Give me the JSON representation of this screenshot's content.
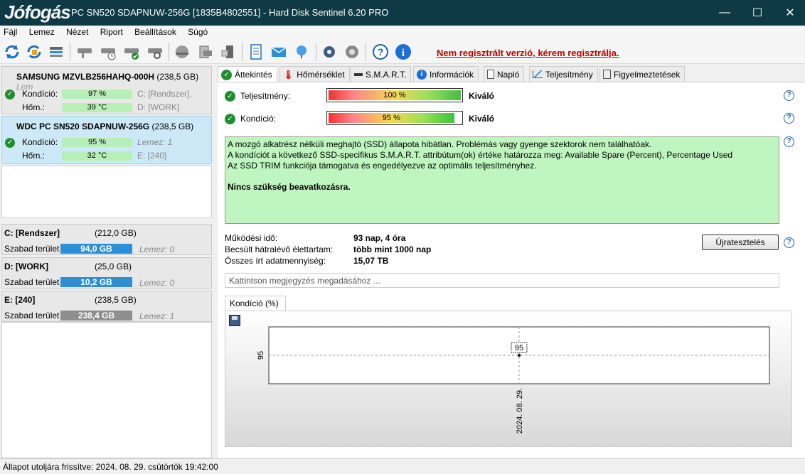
{
  "window": {
    "watermark": "Jófogás",
    "title": "PC SN520 SDAPNUW-256G [1835B4802551]  -  Hard Disk Sentinel 6.20 PRO",
    "minimize": "—",
    "maximize": "☐",
    "close": "✕"
  },
  "menu": [
    "Fájl",
    "Lemez",
    "Nézet",
    "Riport",
    "Beállítások",
    "Súgó"
  ],
  "toolbar": {
    "register_note": "Nem regisztrált verzió, kérem regisztrálja."
  },
  "disks": [
    {
      "name": "SAMSUNG MZVLB256HAHQ-000H",
      "size": "(238,5 GB)",
      "extra": "Lem",
      "condition_label": "Kondíció:",
      "condition": "97 %",
      "condition_pct": 97,
      "temp_label": "Hőm.:",
      "temp": "39 °C",
      "vol1": "C: [Rendszer],",
      "vol2": "D: [WORK]"
    },
    {
      "name": "WDC PC SN520 SDAPNUW-256G",
      "size": "(238,5 GB)",
      "condition_label": "Kondíció:",
      "condition": "95 %",
      "condition_pct": 95,
      "temp_label": "Hőm.:",
      "temp": "32 °C",
      "vol1": "Lemez: 1",
      "vol2": "E: [240]"
    }
  ],
  "partitions": [
    {
      "name": "C: [Rendszer]",
      "size": "(212,0 GB)",
      "free_label": "Szabad terület",
      "free": "94,0 GB",
      "color": "#2d8fd6",
      "disk": "Lemez: 0"
    },
    {
      "name": "D: [WORK]",
      "size": "(25,0 GB)",
      "free_label": "Szabad terület",
      "free": "10,2 GB",
      "color": "#2d8fd6",
      "disk": "Lemez: 0"
    },
    {
      "name": "E: [240]",
      "size": "(238,5 GB)",
      "free_label": "Szabad terület",
      "free": "238,4 GB",
      "color": "#8e8e8e",
      "disk": "Lemez: 1"
    }
  ],
  "tabs": [
    "Áttekintés",
    "Hőmérséklet",
    "S.M.A.R.T.",
    "Információk",
    "Napló",
    "Teljesítmény",
    "Figyelmeztetések"
  ],
  "overview": {
    "performance_label": "Teljesítmény:",
    "performance_value": "100 %",
    "performance_pct": 100,
    "performance_rating": "Kiváló",
    "condition_label": "Kondíció:",
    "condition_value": "95 %",
    "condition_pct": 95,
    "condition_rating": "Kiváló",
    "info_lines": [
      "A mozgó alkatrész nélküli meghajtó (SSD) állapota hibátlan. Problémás vagy gyenge szektorok nem találhatóak.",
      "A kondíciót a következő SSD-specifikus S.M.A.R.T. attribútum(ok) értéke határozza meg:  Available Spare (Percent), Percentage Used",
      "Az SSD TRIM funkciója támogatva és engedélyezve az optimális teljesítményhez."
    ],
    "info_bold": "Nincs szükség beavatkozásra.",
    "uptime_label": "Működési idő:",
    "uptime": "93 nap, 4 óra",
    "lifetime_label": "Becsült hátralévő élettartam:",
    "lifetime": "több mint 1000 nap",
    "written_label": "Összes írt adatmennyiség:",
    "written": "15,07 TB",
    "retest_button": "Újratesztelés",
    "note_placeholder": "Kattintson megjegyzés megadásához ...",
    "chart_tab": "Kondíció  (%)"
  },
  "chart_data": {
    "type": "line",
    "title": "",
    "x": [
      "2024. 08. 29."
    ],
    "series": [
      {
        "values": [
          95
        ]
      }
    ],
    "ylabel": "",
    "y_tick_labels": [
      "95"
    ],
    "data_labels": [
      "95"
    ]
  },
  "status": "Állapot utoljára frissítve: 2024. 08. 29. csütörtök 19:42:00"
}
